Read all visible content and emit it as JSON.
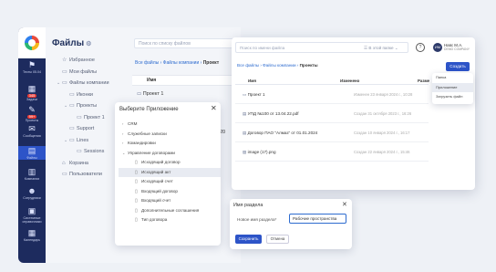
{
  "rail": {
    "items": [
      {
        "label": "Тесты 05.04",
        "icon": "flag-icon"
      },
      {
        "label": "Задачи",
        "icon": "calendar-icon",
        "badge": "345"
      },
      {
        "label": "Проекты",
        "icon": "pencil-icon",
        "badge": "99+"
      },
      {
        "label": "Сообщения",
        "icon": "chat-icon"
      },
      {
        "label": "Файлы",
        "icon": "file-icon"
      },
      {
        "label": "Компании",
        "icon": "building-icon"
      },
      {
        "label": "Сотрудники",
        "icon": "people-icon"
      },
      {
        "label": "Системные справочники",
        "icon": "book-icon"
      },
      {
        "label": "Календарь",
        "icon": "calendar-icon"
      }
    ]
  },
  "main": {
    "title": "Файлы",
    "search_placeholder": "Поиск по списку файлов",
    "tree": [
      {
        "label": "Избранное",
        "indent": 0,
        "chev": "",
        "icon": "star"
      },
      {
        "label": "Мои файлы",
        "indent": 0,
        "chev": "",
        "icon": "folder"
      },
      {
        "label": "Файлы компании",
        "indent": 0,
        "chev": "⌄",
        "icon": "folder"
      },
      {
        "label": "Иконки",
        "indent": 1,
        "chev": "",
        "icon": "folder"
      },
      {
        "label": "Проекты",
        "indent": 1,
        "chev": "⌄",
        "icon": "folder"
      },
      {
        "label": "Проект 1",
        "indent": 2,
        "chev": "",
        "icon": "folder"
      },
      {
        "label": "Support",
        "indent": 1,
        "chev": "",
        "icon": "folder"
      },
      {
        "label": "Lines",
        "indent": 1,
        "chev": "⌄",
        "icon": "folder"
      },
      {
        "label": "Sessions",
        "indent": 2,
        "chev": "",
        "icon": "folder"
      },
      {
        "label": "Корзина",
        "indent": 0,
        "chev": "",
        "icon": "trash"
      },
      {
        "label": "Пользователи",
        "indent": 0,
        "chev": "",
        "icon": "folder"
      }
    ],
    "breadcrumb": {
      "a": "Все файлы",
      "b": "Файлы компании",
      "c": "Проект"
    },
    "table_head": "Имя",
    "row1": "Проект 1",
    "row2_partial": "20"
  },
  "apps_dialog": {
    "title": "Выберите Приложение",
    "items": [
      {
        "label": "CRM",
        "chev": "›",
        "indent": 0
      },
      {
        "label": "Служебные записки",
        "chev": "›",
        "indent": 0
      },
      {
        "label": "Командировки",
        "chev": "›",
        "indent": 0
      },
      {
        "label": "Управление договорами",
        "chev": "⌄",
        "indent": 0
      },
      {
        "label": "Исходящий договор",
        "chev": "",
        "indent": 1
      },
      {
        "label": "Исходящий акт",
        "chev": "",
        "indent": 1,
        "selected": true
      },
      {
        "label": "Исходящий счет",
        "chev": "",
        "indent": 1
      },
      {
        "label": "Входящий договор",
        "chev": "",
        "indent": 1
      },
      {
        "label": "Входящий счет",
        "chev": "",
        "indent": 1
      },
      {
        "label": "Дополнительные соглашения",
        "chev": "",
        "indent": 1
      },
      {
        "label": "Тип договора",
        "chev": "",
        "indent": 1
      }
    ]
  },
  "window": {
    "search_placeholder": "Поиск по имени файла",
    "filter_label": "В этой папке",
    "help": "?",
    "avatar": "ИМ",
    "user_name": "Навс М.А.",
    "user_company": "DEMO COMPANY",
    "breadcrumb": {
      "a": "Все файлы",
      "b": "Файлы компании",
      "c": "Проекты"
    },
    "create_label": "Создать",
    "cols": {
      "name": "Имя",
      "modified": "Изменено",
      "size": "Разме"
    },
    "rows": [
      {
        "name": "Проект 1",
        "date": "Изменен 23 января 2024 г., 10:28",
        "icon": "folder"
      },
      {
        "name": "УПД №100 от 13.04.22.pdf",
        "date": "Создан 31 октября 2023 г., 16:26",
        "icon": "doc"
      },
      {
        "name": "Договор ПАО \"Алмаз\" от 01.01.2024",
        "date": "Создан 10 января 2024 г., 16:17",
        "icon": "doc"
      },
      {
        "name": "image (17).png",
        "date": "Создан 22 января 2024 г., 15:46",
        "icon": "image"
      }
    ],
    "menu": [
      "Папка",
      "Приложение",
      "Загрузить файл"
    ]
  },
  "section_dialog": {
    "title": "Имя раздела",
    "field_label": "Новое имя раздела*",
    "field_value": "Рабочие пространства",
    "save_label": "Сохранить",
    "cancel_label": "Отмена"
  }
}
